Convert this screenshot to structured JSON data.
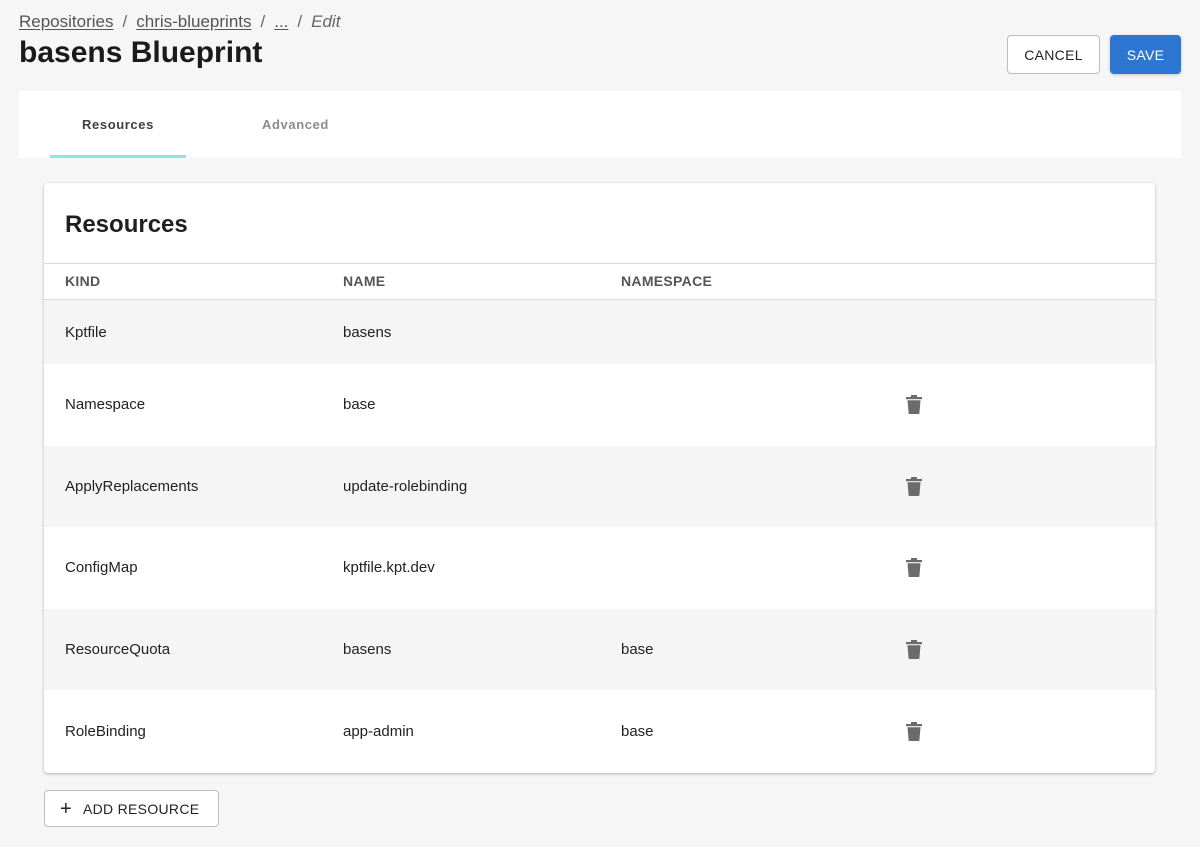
{
  "breadcrumb": {
    "items": [
      "Repositories",
      "chris-blueprints",
      "..."
    ],
    "separator": "/",
    "current": "Edit"
  },
  "page": {
    "title": "basens Blueprint"
  },
  "actions": {
    "cancel_label": "CANCEL",
    "save_label": "SAVE"
  },
  "tabs": [
    {
      "label": "Resources",
      "active": true
    },
    {
      "label": "Advanced",
      "active": false
    }
  ],
  "resources": {
    "title": "Resources",
    "columns": {
      "kind": "KIND",
      "name": "NAME",
      "namespace": "NAMESPACE"
    },
    "rows": [
      {
        "kind": "Kptfile",
        "name": "basens",
        "namespace": "",
        "deletable": false
      },
      {
        "kind": "Namespace",
        "name": "base",
        "namespace": "",
        "deletable": true
      },
      {
        "kind": "ApplyReplacements",
        "name": "update-rolebinding",
        "namespace": "",
        "deletable": true
      },
      {
        "kind": "ConfigMap",
        "name": "kptfile.kpt.dev",
        "namespace": "",
        "deletable": true
      },
      {
        "kind": "ResourceQuota",
        "name": "basens",
        "namespace": "base",
        "deletable": true
      },
      {
        "kind": "RoleBinding",
        "name": "app-admin",
        "namespace": "base",
        "deletable": true
      }
    ],
    "delete_icon": "trash-icon"
  },
  "add_resource": {
    "label": "ADD RESOURCE",
    "icon": "plus-icon"
  },
  "colors": {
    "primary": "#2d76d2",
    "tab_indicator": "#8ee6dc",
    "background": "#f6f6f6"
  }
}
